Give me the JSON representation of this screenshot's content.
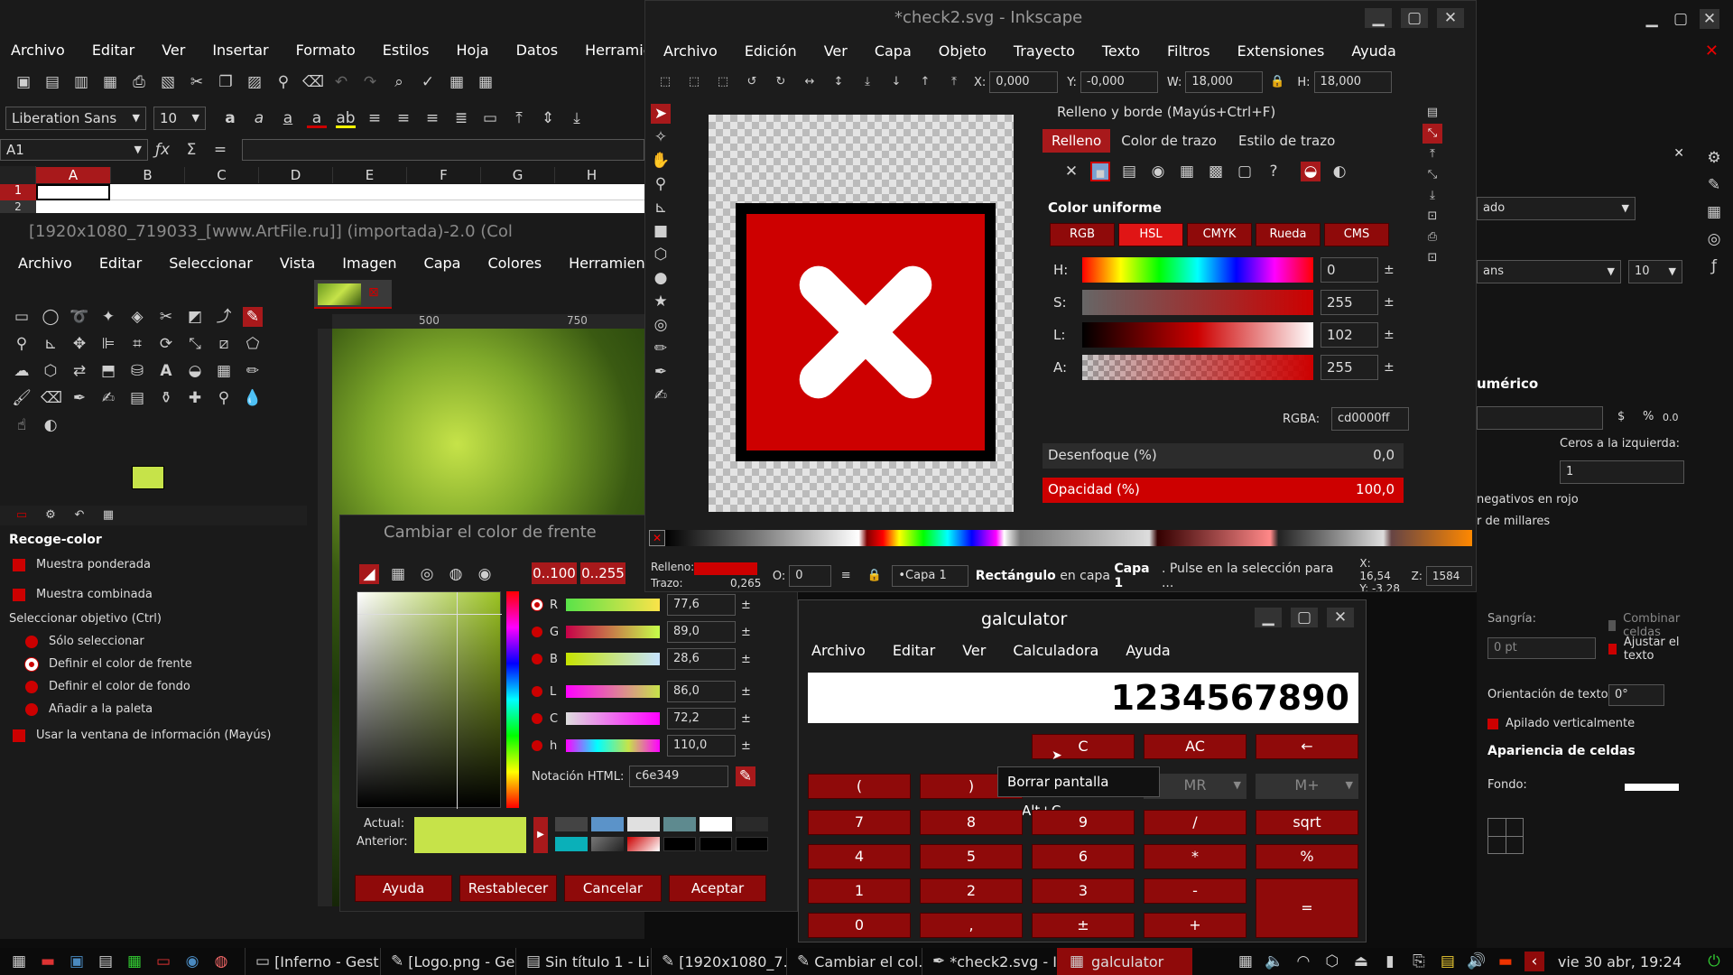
{
  "calc_window": {
    "title": "*check2.svg - Inkscape",
    "menu": [
      "Archivo",
      "Edición",
      "Ver",
      "Capa",
      "Objeto",
      "Trayecto",
      "Texto",
      "Filtros",
      "Extensiones",
      "Ayuda"
    ],
    "coords": {
      "x_label": "X:",
      "x": "0,000",
      "y_label": "Y:",
      "y": "-0,000",
      "w_label": "W:",
      "w": "18,000",
      "h_label": "H:",
      "h": "18,000"
    },
    "fill_panel": {
      "title": "Relleno y borde (Mayús+Ctrl+F)",
      "tabs": [
        "Relleno",
        "Color de trazo",
        "Estilo de trazo"
      ],
      "uniform": "Color uniforme",
      "modes": [
        "RGB",
        "HSL",
        "CMYK",
        "Rueda",
        "CMS"
      ],
      "sliders": [
        {
          "label": "H:",
          "value": "0"
        },
        {
          "label": "S:",
          "value": "255"
        },
        {
          "label": "L:",
          "value": "102"
        },
        {
          "label": "A:",
          "value": "255"
        }
      ],
      "rgba_label": "RGBA:",
      "rgba": "cd0000ff",
      "blur_label": "Desenfoque (%)",
      "blur": "0,0",
      "opacity_label": "Opacidad (%)",
      "opacity": "100,0"
    },
    "status": {
      "fill_label": "Relleno:",
      "stroke_label": "Trazo:",
      "stroke_val": "0,265",
      "o_label": "O:",
      "o_val": "0",
      "layer": "•Capa 1",
      "msg_bold": "Rectángulo",
      "msg": " en capa ",
      "msg_layer": "Capa 1",
      "msg_end": ". Pulse en la selección para ...",
      "x": "X:  16,54",
      "y": "Y:  -3,28",
      "zoom_label": "Z:",
      "zoom": "1584"
    }
  },
  "calc": {
    "title": "*check2.svg - Inkscape"
  },
  "libre": {
    "menu": [
      "Archivo",
      "Editar",
      "Ver",
      "Insertar",
      "Formato",
      "Estilos",
      "Hoja",
      "Datos",
      "Herramientas"
    ],
    "font": "Liberation Sans",
    "size": "10",
    "cell": "A1",
    "cols": [
      "A",
      "B",
      "C",
      "D",
      "E",
      "F",
      "G",
      "H"
    ],
    "rows": [
      "1",
      "2"
    ]
  },
  "gimp": {
    "title": "[1920x1080_719033_[www.ArtFile.ru]] (importada)-2.0 (Col",
    "menu": [
      "Archivo",
      "Editar",
      "Seleccionar",
      "Vista",
      "Imagen",
      "Capa",
      "Colores",
      "Herramientas"
    ],
    "ruler": [
      "500",
      "750"
    ],
    "picker": {
      "title": "Recoge-color",
      "opts": [
        "Muestra ponderada",
        "Muestra combinada"
      ],
      "target": "Seleccionar objetivo  (Ctrl)",
      "radios": [
        "Sólo seleccionar",
        "Definir el color de frente",
        "Definir el color de fondo",
        "Añadir a la paleta"
      ],
      "info": "Usar la ventana de información  (Mayús)"
    }
  },
  "fg_dialog": {
    "title": "Cambiar el color de frente",
    "range1": "0..100",
    "range2": "0..255",
    "channels": [
      {
        "label": "R",
        "value": "77,6"
      },
      {
        "label": "G",
        "value": "89,0"
      },
      {
        "label": "B",
        "value": "28,6"
      },
      {
        "label": "L",
        "value": "86,0"
      },
      {
        "label": "C",
        "value": "72,2"
      },
      {
        "label": "h",
        "value": "110,0"
      }
    ],
    "html_label": "Notación HTML:",
    "html": "c6e349",
    "actual": "Actual:",
    "anterior": "Anterior:",
    "buttons": [
      "Ayuda",
      "Restablecer",
      "Cancelar",
      "Aceptar"
    ]
  },
  "galc": {
    "title": "galculator",
    "menu": [
      "Archivo",
      "Editar",
      "Ver",
      "Calculadora",
      "Ayuda"
    ],
    "display": "1234567890",
    "row1": [
      "C",
      "AC",
      "←"
    ],
    "tooltip": "Borrar pantalla",
    "tooltip_key": "Alt+C",
    "row2": [
      "(",
      ")",
      "MR",
      "M+"
    ],
    "row3": [
      "7",
      "8",
      "9",
      "/",
      "sqrt"
    ],
    "row4": [
      "4",
      "5",
      "6",
      "*",
      "%"
    ],
    "row5": [
      "1",
      "2",
      "3",
      "-"
    ],
    "row6": [
      "0",
      ",",
      "±",
      "+"
    ],
    "equals": "="
  },
  "right_panel": {
    "fragments": {
      "ado": "ado",
      "ans": "ans",
      "size": "10",
      "numeric": "umérico",
      "zeros": "Ceros a la izquierda:",
      "zeros_val": "1",
      "neg": "negativos en rojo",
      "thousands": "r de millares",
      "pct": "%",
      "dec": "0.0",
      "dollar": "$"
    },
    "indent": "Sangría:",
    "indent_val": "0 pt",
    "merge": "Combinar celdas",
    "wrap": "Ajustar el texto",
    "orientation": "Orientación de texto:",
    "orientation_val": "0°",
    "stack": "Apilado verticalmente",
    "appearance": "Apariencia de celdas",
    "bg": "Fondo:"
  },
  "taskbar": {
    "items": [
      "[Inferno - Gest...",
      "[Logo.png - Ge...",
      "Sin título 1 - Li...",
      "[1920x1080_7...",
      "Cambiar el col...",
      "*check2.svg - I...",
      "galculator"
    ],
    "clock": "vie 30 abr, 19:24"
  },
  "colors": {
    "accent": "#cc0000",
    "calc_btn": "#8b0e0e",
    "fg": "#c6e349"
  }
}
